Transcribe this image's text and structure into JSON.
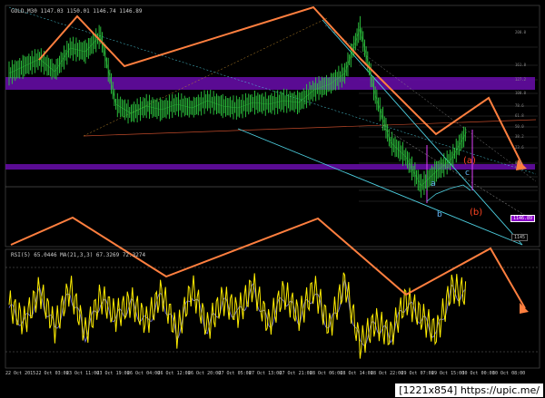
{
  "chart_title": "GOLD,M30  1147.03 1150.01 1146.74 1146.89",
  "indicator_title": "RSI(5) 65.0446 MA(21,3,3) 67.3269 72.3274",
  "colors": {
    "background": "#000000",
    "bull_candle": "#2ecc40",
    "purple_zone": "#6a0dad",
    "zigzag": "#ff7f3f",
    "channel_line": "#4dd0e1",
    "rsi_line": "#ffee00",
    "rsi_ma": "#6f6fd8"
  },
  "wave_labels": {
    "a": "a",
    "b": "b",
    "c": "c",
    "big_a": "(a)",
    "big_b": "(b)"
  },
  "price_tag": "1146.89",
  "sl_tag": "1145",
  "right_axis_labels": [
    "200.0",
    "161.8",
    "127.2",
    "100.0",
    "78.6",
    "61.8",
    "50.0",
    "38.2",
    "23.6",
    "0.0"
  ],
  "x_axis_labels": [
    "22 Oct 2015",
    "22 Oct 03:00",
    "23 Oct 11:00",
    "23 Oct 19:00",
    "26 Oct 04:00",
    "26 Oct 12:00",
    "26 Oct 20:00",
    "27 Oct 05:00",
    "27 Oct 13:00",
    "27 Oct 21:00",
    "28 Oct 06:00",
    "28 Oct 14:00",
    "28 Oct 22:00",
    "29 Oct 07:00",
    "29 Oct 15:00",
    "30 Oct 00:00",
    "30 Oct 08:00"
  ],
  "watermark": "[1221x854] https://upic.me/",
  "chart_data": {
    "type": "line",
    "title": "GOLD,M30",
    "price_series": {
      "name": "GOLD",
      "x": [
        0,
        4,
        8,
        12,
        16,
        20,
        24,
        28,
        32,
        36,
        40,
        44,
        48,
        52,
        56,
        60,
        64,
        68,
        72,
        76,
        80,
        84,
        88,
        92,
        96,
        100,
        104,
        108,
        112,
        116,
        120
      ],
      "values": [
        72,
        76,
        80,
        73,
        86,
        84,
        93,
        55,
        50,
        54,
        52,
        55,
        53,
        57,
        54,
        53,
        56,
        55,
        57,
        56,
        63,
        66,
        72,
        97,
        60,
        34,
        26,
        10,
        18,
        25,
        40
      ]
    },
    "rsi_series": {
      "name": "RSI(5)",
      "x": [
        0,
        4,
        8,
        12,
        16,
        20,
        24,
        28,
        32,
        36,
        40,
        44,
        48,
        52,
        56,
        60,
        64,
        68,
        72,
        76,
        80,
        84,
        88,
        92,
        96,
        100,
        104,
        108,
        112,
        116,
        120
      ],
      "values": [
        55,
        40,
        68,
        35,
        70,
        30,
        62,
        45,
        58,
        40,
        66,
        30,
        70,
        35,
        60,
        48,
        72,
        38,
        66,
        45,
        70,
        35,
        75,
        20,
        40,
        28,
        60,
        45,
        30,
        70,
        65
      ]
    },
    "ylim_rsi": [
      0,
      100
    ]
  }
}
